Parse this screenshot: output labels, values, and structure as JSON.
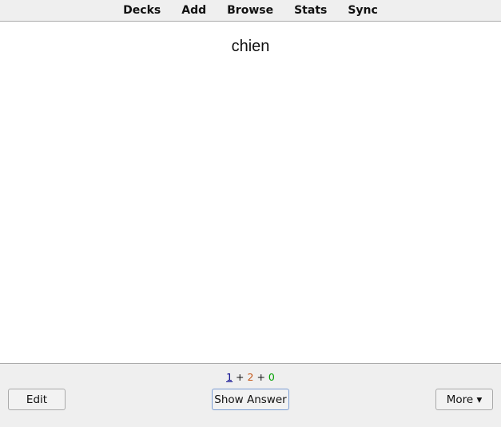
{
  "toolbar": {
    "items": [
      "Decks",
      "Add",
      "Browse",
      "Stats",
      "Sync"
    ]
  },
  "card": {
    "question": "chien"
  },
  "counts": {
    "new": "1",
    "learn": "2",
    "review": "0",
    "sep": "+",
    "colors": {
      "new": "#00008b",
      "learn": "#c35617",
      "review": "#00a000"
    }
  },
  "buttons": {
    "edit": "Edit",
    "show_answer": "Show Answer",
    "more": "More ▾"
  }
}
